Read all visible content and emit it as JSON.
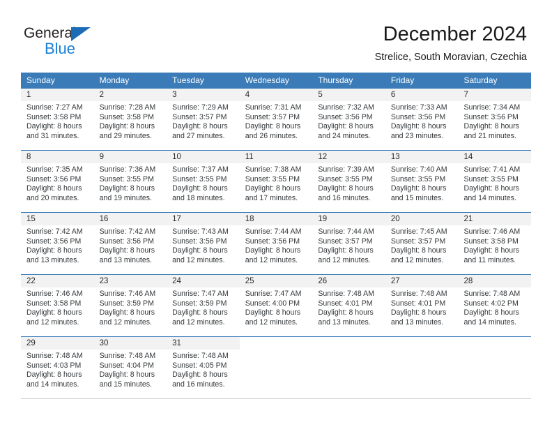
{
  "brand": {
    "name_part1": "General",
    "name_part2": "Blue",
    "triangle_color": "#1b6cb5",
    "blue_text_color": "#1b7fd4"
  },
  "header": {
    "title": "December 2024",
    "subtitle": "Strelice, South Moravian, Czechia"
  },
  "theme": {
    "header_row_bg": "#3b7cb8",
    "daynum_bg": "#f2f2f2",
    "text_color": "#33373a"
  },
  "weekdays": [
    "Sunday",
    "Monday",
    "Tuesday",
    "Wednesday",
    "Thursday",
    "Friday",
    "Saturday"
  ],
  "weeks": [
    {
      "days": [
        {
          "num": "1",
          "sunrise": "Sunrise: 7:27 AM",
          "sunset": "Sunset: 3:58 PM",
          "daylight1": "Daylight: 8 hours",
          "daylight2": "and 31 minutes."
        },
        {
          "num": "2",
          "sunrise": "Sunrise: 7:28 AM",
          "sunset": "Sunset: 3:58 PM",
          "daylight1": "Daylight: 8 hours",
          "daylight2": "and 29 minutes."
        },
        {
          "num": "3",
          "sunrise": "Sunrise: 7:29 AM",
          "sunset": "Sunset: 3:57 PM",
          "daylight1": "Daylight: 8 hours",
          "daylight2": "and 27 minutes."
        },
        {
          "num": "4",
          "sunrise": "Sunrise: 7:31 AM",
          "sunset": "Sunset: 3:57 PM",
          "daylight1": "Daylight: 8 hours",
          "daylight2": "and 26 minutes."
        },
        {
          "num": "5",
          "sunrise": "Sunrise: 7:32 AM",
          "sunset": "Sunset: 3:56 PM",
          "daylight1": "Daylight: 8 hours",
          "daylight2": "and 24 minutes."
        },
        {
          "num": "6",
          "sunrise": "Sunrise: 7:33 AM",
          "sunset": "Sunset: 3:56 PM",
          "daylight1": "Daylight: 8 hours",
          "daylight2": "and 23 minutes."
        },
        {
          "num": "7",
          "sunrise": "Sunrise: 7:34 AM",
          "sunset": "Sunset: 3:56 PM",
          "daylight1": "Daylight: 8 hours",
          "daylight2": "and 21 minutes."
        }
      ]
    },
    {
      "days": [
        {
          "num": "8",
          "sunrise": "Sunrise: 7:35 AM",
          "sunset": "Sunset: 3:56 PM",
          "daylight1": "Daylight: 8 hours",
          "daylight2": "and 20 minutes."
        },
        {
          "num": "9",
          "sunrise": "Sunrise: 7:36 AM",
          "sunset": "Sunset: 3:55 PM",
          "daylight1": "Daylight: 8 hours",
          "daylight2": "and 19 minutes."
        },
        {
          "num": "10",
          "sunrise": "Sunrise: 7:37 AM",
          "sunset": "Sunset: 3:55 PM",
          "daylight1": "Daylight: 8 hours",
          "daylight2": "and 18 minutes."
        },
        {
          "num": "11",
          "sunrise": "Sunrise: 7:38 AM",
          "sunset": "Sunset: 3:55 PM",
          "daylight1": "Daylight: 8 hours",
          "daylight2": "and 17 minutes."
        },
        {
          "num": "12",
          "sunrise": "Sunrise: 7:39 AM",
          "sunset": "Sunset: 3:55 PM",
          "daylight1": "Daylight: 8 hours",
          "daylight2": "and 16 minutes."
        },
        {
          "num": "13",
          "sunrise": "Sunrise: 7:40 AM",
          "sunset": "Sunset: 3:55 PM",
          "daylight1": "Daylight: 8 hours",
          "daylight2": "and 15 minutes."
        },
        {
          "num": "14",
          "sunrise": "Sunrise: 7:41 AM",
          "sunset": "Sunset: 3:55 PM",
          "daylight1": "Daylight: 8 hours",
          "daylight2": "and 14 minutes."
        }
      ]
    },
    {
      "days": [
        {
          "num": "15",
          "sunrise": "Sunrise: 7:42 AM",
          "sunset": "Sunset: 3:56 PM",
          "daylight1": "Daylight: 8 hours",
          "daylight2": "and 13 minutes."
        },
        {
          "num": "16",
          "sunrise": "Sunrise: 7:42 AM",
          "sunset": "Sunset: 3:56 PM",
          "daylight1": "Daylight: 8 hours",
          "daylight2": "and 13 minutes."
        },
        {
          "num": "17",
          "sunrise": "Sunrise: 7:43 AM",
          "sunset": "Sunset: 3:56 PM",
          "daylight1": "Daylight: 8 hours",
          "daylight2": "and 12 minutes."
        },
        {
          "num": "18",
          "sunrise": "Sunrise: 7:44 AM",
          "sunset": "Sunset: 3:56 PM",
          "daylight1": "Daylight: 8 hours",
          "daylight2": "and 12 minutes."
        },
        {
          "num": "19",
          "sunrise": "Sunrise: 7:44 AM",
          "sunset": "Sunset: 3:57 PM",
          "daylight1": "Daylight: 8 hours",
          "daylight2": "and 12 minutes."
        },
        {
          "num": "20",
          "sunrise": "Sunrise: 7:45 AM",
          "sunset": "Sunset: 3:57 PM",
          "daylight1": "Daylight: 8 hours",
          "daylight2": "and 12 minutes."
        },
        {
          "num": "21",
          "sunrise": "Sunrise: 7:46 AM",
          "sunset": "Sunset: 3:58 PM",
          "daylight1": "Daylight: 8 hours",
          "daylight2": "and 11 minutes."
        }
      ]
    },
    {
      "days": [
        {
          "num": "22",
          "sunrise": "Sunrise: 7:46 AM",
          "sunset": "Sunset: 3:58 PM",
          "daylight1": "Daylight: 8 hours",
          "daylight2": "and 12 minutes."
        },
        {
          "num": "23",
          "sunrise": "Sunrise: 7:46 AM",
          "sunset": "Sunset: 3:59 PM",
          "daylight1": "Daylight: 8 hours",
          "daylight2": "and 12 minutes."
        },
        {
          "num": "24",
          "sunrise": "Sunrise: 7:47 AM",
          "sunset": "Sunset: 3:59 PM",
          "daylight1": "Daylight: 8 hours",
          "daylight2": "and 12 minutes."
        },
        {
          "num": "25",
          "sunrise": "Sunrise: 7:47 AM",
          "sunset": "Sunset: 4:00 PM",
          "daylight1": "Daylight: 8 hours",
          "daylight2": "and 12 minutes."
        },
        {
          "num": "26",
          "sunrise": "Sunrise: 7:48 AM",
          "sunset": "Sunset: 4:01 PM",
          "daylight1": "Daylight: 8 hours",
          "daylight2": "and 13 minutes."
        },
        {
          "num": "27",
          "sunrise": "Sunrise: 7:48 AM",
          "sunset": "Sunset: 4:01 PM",
          "daylight1": "Daylight: 8 hours",
          "daylight2": "and 13 minutes."
        },
        {
          "num": "28",
          "sunrise": "Sunrise: 7:48 AM",
          "sunset": "Sunset: 4:02 PM",
          "daylight1": "Daylight: 8 hours",
          "daylight2": "and 14 minutes."
        }
      ]
    },
    {
      "days": [
        {
          "num": "29",
          "sunrise": "Sunrise: 7:48 AM",
          "sunset": "Sunset: 4:03 PM",
          "daylight1": "Daylight: 8 hours",
          "daylight2": "and 14 minutes."
        },
        {
          "num": "30",
          "sunrise": "Sunrise: 7:48 AM",
          "sunset": "Sunset: 4:04 PM",
          "daylight1": "Daylight: 8 hours",
          "daylight2": "and 15 minutes."
        },
        {
          "num": "31",
          "sunrise": "Sunrise: 7:48 AM",
          "sunset": "Sunset: 4:05 PM",
          "daylight1": "Daylight: 8 hours",
          "daylight2": "and 16 minutes."
        },
        {
          "num": "",
          "sunrise": "",
          "sunset": "",
          "daylight1": "",
          "daylight2": ""
        },
        {
          "num": "",
          "sunrise": "",
          "sunset": "",
          "daylight1": "",
          "daylight2": ""
        },
        {
          "num": "",
          "sunrise": "",
          "sunset": "",
          "daylight1": "",
          "daylight2": ""
        },
        {
          "num": "",
          "sunrise": "",
          "sunset": "",
          "daylight1": "",
          "daylight2": ""
        }
      ]
    }
  ]
}
